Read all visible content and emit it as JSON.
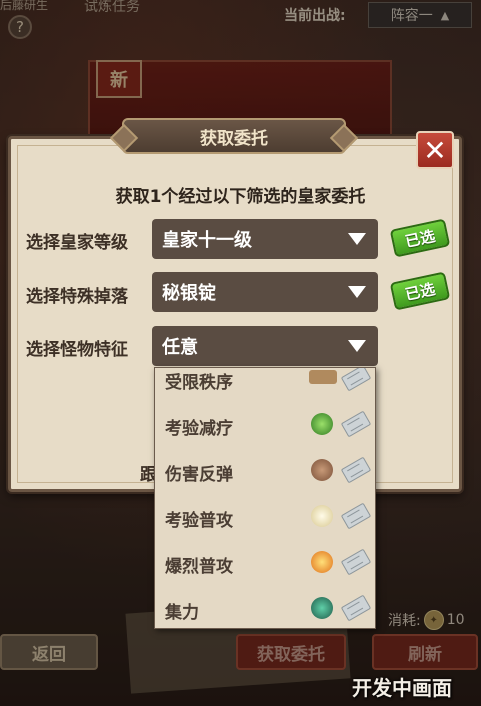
{
  "top": {
    "left_text": "后藤研生",
    "sub_title": "试炼任务",
    "help_glyph": "?",
    "lineup_label": "当前出战:",
    "lineup_value": "阵容一"
  },
  "banner": {
    "new_badge": "新"
  },
  "dialog": {
    "title": "获取委托",
    "close_glyph": "✕",
    "headline": "获取1个经过以下筛选的皇家委托",
    "rows": [
      {
        "label": "选择皇家等级",
        "value": "皇家十一级",
        "status": "已选"
      },
      {
        "label": "选择特殊掉落",
        "value": "秘银锭",
        "status": "已选"
      },
      {
        "label": "选择怪物特征",
        "value": "任意"
      }
    ],
    "behind_text": "跟"
  },
  "dropdown": {
    "options": [
      {
        "label": "受限秩序",
        "icon": "scroll-icon",
        "color": "#b08a5e"
      },
      {
        "label": "考验减疗",
        "icon": "green-orb-icon",
        "color": "#4aa83a"
      },
      {
        "label": "伤害反弹",
        "icon": "spiked-shell-icon",
        "color": "#a07050"
      },
      {
        "label": "考验普攻",
        "icon": "crescent-icon",
        "color": "#e8dcb0"
      },
      {
        "label": "爆烈普攻",
        "icon": "fire-icon",
        "color": "#e8862a"
      },
      {
        "label": "集力",
        "icon": "teal-crystal-icon",
        "color": "#2f7a64"
      }
    ]
  },
  "bottom": {
    "back": "返回",
    "get": "获取委托",
    "refresh": "刷新",
    "cost_label": "消耗:",
    "cost_value": "10"
  },
  "watermark": "开发中画面"
}
